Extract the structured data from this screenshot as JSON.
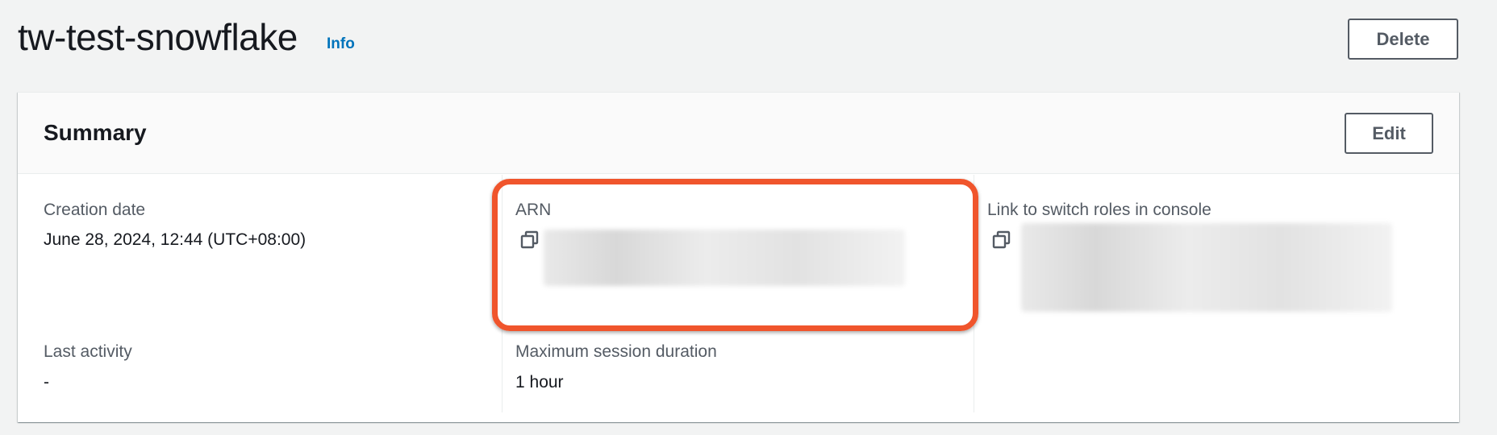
{
  "header": {
    "title": "tw-test-snowflake",
    "info_link": "Info",
    "delete_label": "Delete"
  },
  "summary": {
    "title": "Summary",
    "edit_label": "Edit",
    "fields": {
      "creation_date": {
        "label": "Creation date",
        "value": "June 28, 2024, 12:44 (UTC+08:00)"
      },
      "arn": {
        "label": "ARN",
        "value_redacted": true
      },
      "switch_role_link": {
        "label": "Link to switch roles in console",
        "value_redacted": true
      },
      "last_activity": {
        "label": "Last activity",
        "value": "-"
      },
      "max_session_duration": {
        "label": "Maximum session duration",
        "value": "1 hour"
      }
    }
  },
  "colors": {
    "accent_link": "#0073bb",
    "highlight": "#f0552c",
    "text_primary": "#16191f",
    "text_secondary": "#545b64"
  },
  "icons": {
    "copy": "copy-icon"
  }
}
